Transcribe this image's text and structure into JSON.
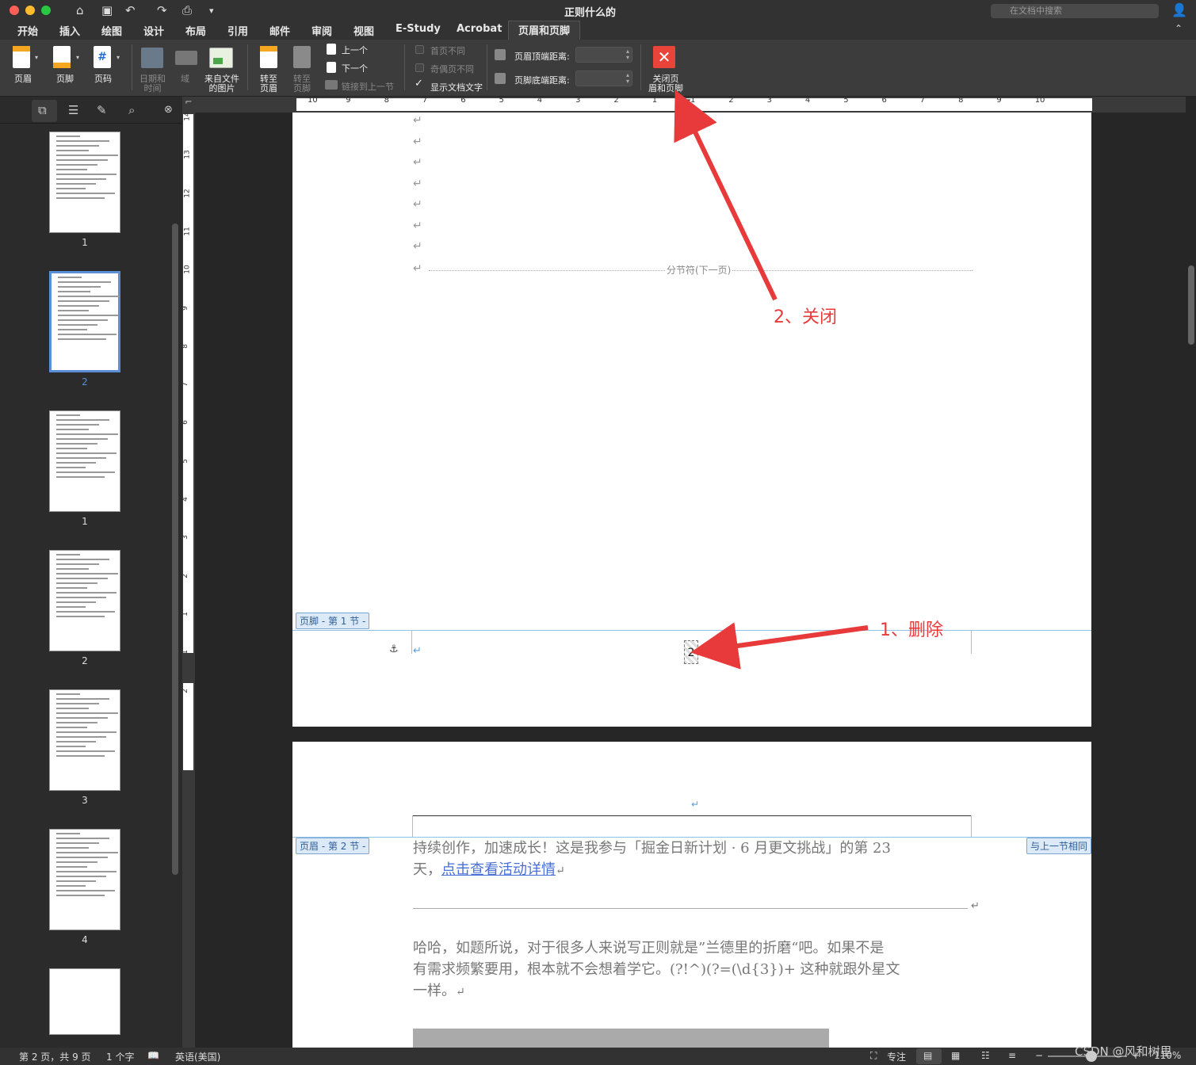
{
  "titlebar": {
    "doc_title": "正则什么的",
    "search_placeholder": "在文档中搜索"
  },
  "tabs": [
    "开始",
    "插入",
    "绘图",
    "设计",
    "布局",
    "引用",
    "邮件",
    "审阅",
    "视图",
    "E-Study",
    "Acrobat",
    "页眉和页脚"
  ],
  "share_label": "共享",
  "ribbon": {
    "header": "页眉",
    "footer": "页脚",
    "page_number": "页码",
    "date_time": "日期和\n时间",
    "field": "域",
    "picture_from_file": "来自文件\n的图片",
    "goto_header": "转至\n页眉",
    "goto_footer": "转至\n页脚",
    "previous": "上一个",
    "next": "下一个",
    "link_to_previous": "链接到上一节",
    "different_first_page": "首页不同",
    "different_odd_even": "奇偶页不同",
    "show_document_text": "显示文档文字",
    "header_from_top": "页眉顶端距离:",
    "footer_from_bottom": "页脚底端距离:",
    "close": "关闭页\n眉和页脚"
  },
  "thumbnails": [
    {
      "num": "1",
      "selected": false
    },
    {
      "num": "2",
      "selected": true
    },
    {
      "num": "1",
      "selected": false
    },
    {
      "num": "2",
      "selected": false
    },
    {
      "num": "3",
      "selected": false
    },
    {
      "num": "4",
      "selected": false
    }
  ],
  "hruler_ticks": [
    "10",
    "9",
    "8",
    "7",
    "6",
    "5",
    "4",
    "3",
    "2",
    "1",
    "1",
    "2",
    "3",
    "4",
    "5",
    "6",
    "7",
    "8",
    "9",
    "10"
  ],
  "vruler_ticks": [
    "14",
    "13",
    "12",
    "11",
    "10",
    "9",
    "8",
    "7",
    "6",
    "5",
    "4",
    "3",
    "2",
    "1",
    "1",
    "2"
  ],
  "page1": {
    "section_break": "分节符(下一页)",
    "footer_label": "页脚 - 第 1 节 -",
    "page_number_field": "2"
  },
  "page2": {
    "header_label": "页眉 - 第 2 节 -",
    "same_as_previous": "与上一节相同",
    "line1": "持续创作，加速成长！这是我参与「掘金日新计划 · 6 月更文挑战」的第 23",
    "line2_prefix": "天，",
    "line2_link": "点击查看活动详情",
    "para2_line1": "哈哈，如题所说，对于很多人来说写正则就是”兰德里的折磨“吧。如果不是",
    "para2_line2": "有需求频繁要用，根本就不会想着学它。(?!^)(?=(\\d{3})+ 这种就跟外星文",
    "para2_line3": "一样。"
  },
  "annotations": {
    "close": "2、关闭",
    "delete": "1、删除"
  },
  "status": {
    "page": "第 2 页，共 9 页",
    "words": "1 个字",
    "language": "英语(美国)",
    "focus": "专注",
    "zoom": "110%"
  },
  "watermark": "CSDN @风和树里",
  "colors": {
    "accent": "#5a8ed6",
    "annotation": "#e83a3a",
    "close_button": "#e8443a"
  }
}
